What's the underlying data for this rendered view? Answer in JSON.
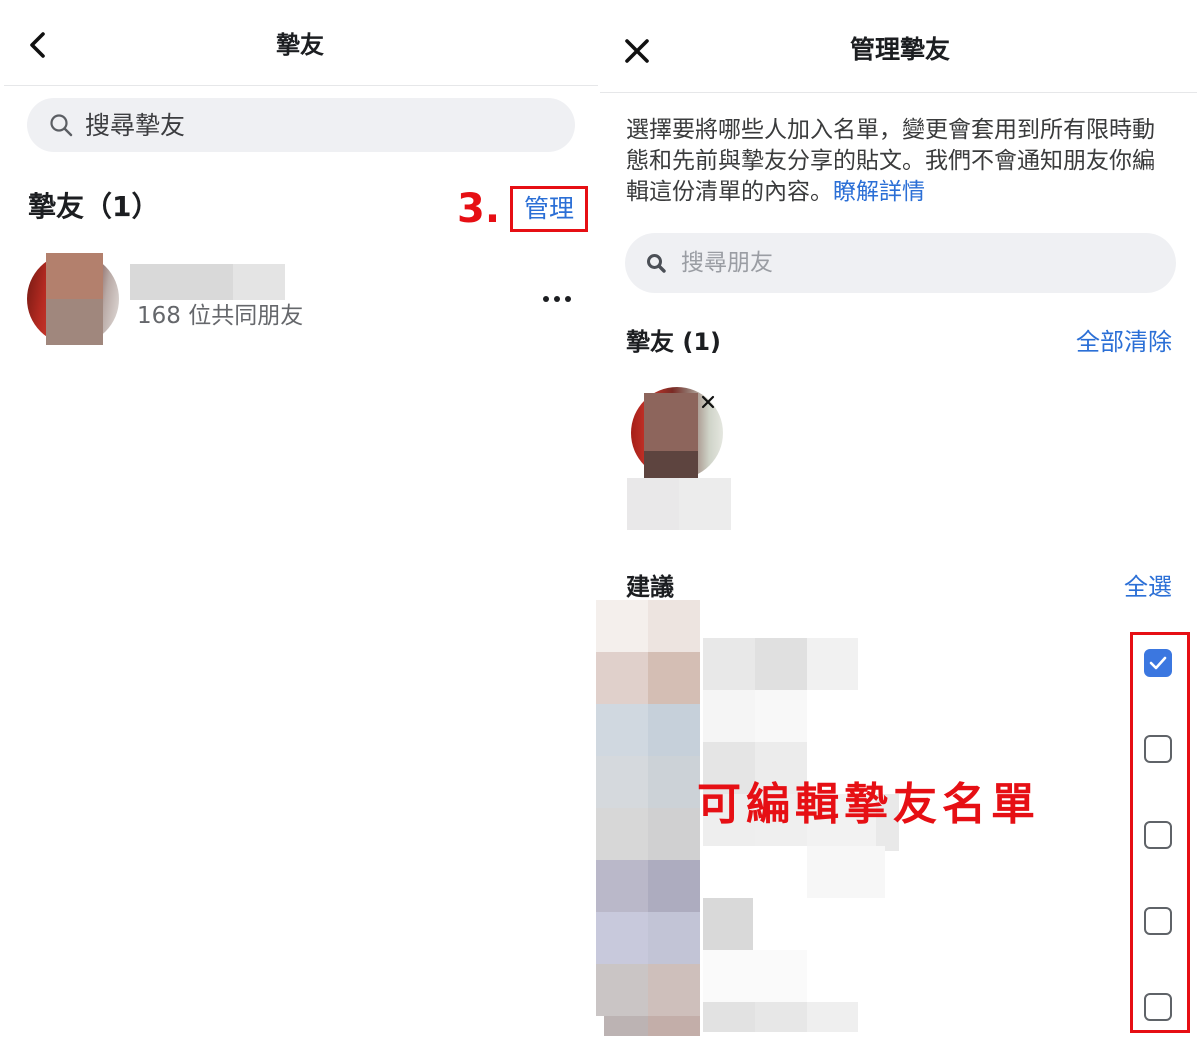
{
  "colors": {
    "accent_blue": "#2b6fd6",
    "annotation_red": "#e60f14",
    "checkbox_checked": "#3b77e0",
    "search_background": "#eff0f3"
  },
  "left_screen": {
    "header": {
      "back_icon": "chevron-left-icon",
      "title": "摯友"
    },
    "search": {
      "icon": "search-icon",
      "placeholder": "搜尋摯友"
    },
    "friends_section": {
      "title": "摯友（1）",
      "manage_label": "管理"
    },
    "annotation_step": "3.",
    "friends": [
      {
        "mutual_friends": "168 位共同朋友",
        "more_icon": "more-horizontal-icon"
      }
    ]
  },
  "right_screen": {
    "header": {
      "close_icon": "close-icon",
      "title": "管理摯友"
    },
    "description": "選擇要將哪些人加入名單，變更會套用到所有限時動態和先前與摯友分享的貼文。我們不會通知朋友你編輯這份清單的內容。",
    "learn_more_link": "瞭解詳情",
    "search": {
      "icon": "search-icon",
      "placeholder": "搜尋朋友"
    },
    "selected_section": {
      "title": "摯友 (1)",
      "clear_all_label": "全部清除"
    },
    "selected_friends": [
      {
        "remove_icon": "remove-x-icon"
      }
    ],
    "suggestions_section": {
      "title": "建議",
      "select_all_label": "全選"
    },
    "suggestions": [
      {
        "checked": true
      },
      {
        "checked": false
      },
      {
        "checked": false
      },
      {
        "checked": false
      },
      {
        "checked": false
      }
    ],
    "annotation": "可編輯摯友名單"
  }
}
